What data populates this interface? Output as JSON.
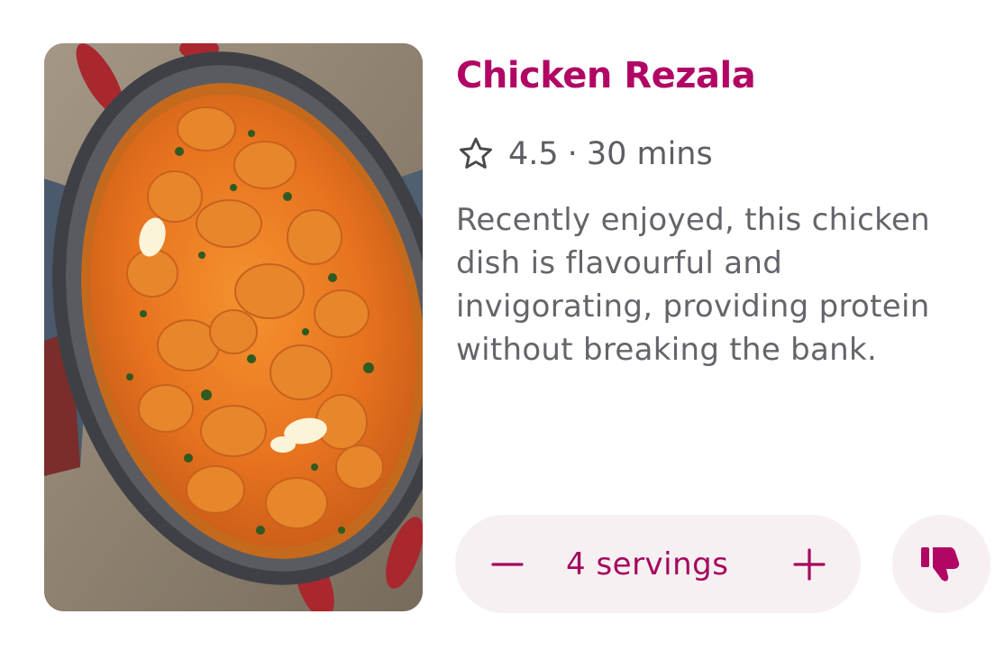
{
  "recipe": {
    "title": "Chicken Rezala",
    "rating": "4.5",
    "separator": "·",
    "duration": "30 mins",
    "description": "Recently enjoyed, this chicken dish is flavourful and invigorating, providing protein without breaking the bank."
  },
  "servings": {
    "label": "4 servings",
    "count": 4
  },
  "icons": {
    "rating": "star-outline-icon",
    "decrease": "minus-icon",
    "increase": "plus-icon",
    "dislike": "thumbs-down-icon"
  },
  "colors": {
    "accent": "#b10664",
    "text_secondary": "#5f5d63",
    "pill_background": "#f6f0f2"
  }
}
